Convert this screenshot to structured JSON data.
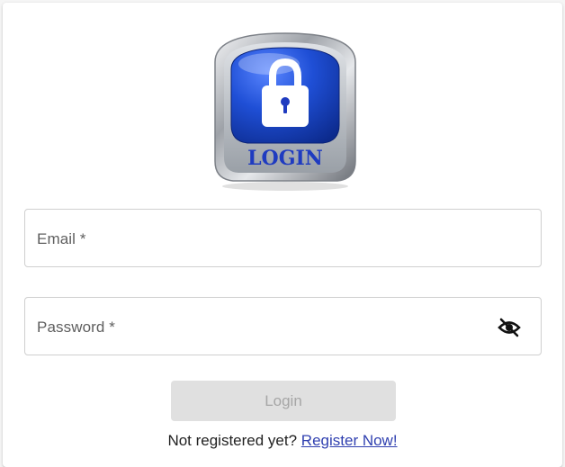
{
  "logo": {
    "text": "LOGIN",
    "icon": "padlock-icon",
    "colors": {
      "disk": "#1f4fd6",
      "ring": "#b9bcc2",
      "lock": "#ffffff",
      "text": "#1f3bc0"
    }
  },
  "form": {
    "email": {
      "label": "Email *",
      "value": ""
    },
    "password": {
      "label": "Password *",
      "value": "",
      "toggle_icon": "eye-off-icon"
    },
    "submit_label": "Login",
    "submit_enabled": false
  },
  "footer": {
    "prompt": "Not registered yet?",
    "register_link": "Register Now!"
  },
  "colors": {
    "link": "#3040b0",
    "button_disabled_bg": "#e0e0e0",
    "button_disabled_text": "#a6a6a6"
  }
}
